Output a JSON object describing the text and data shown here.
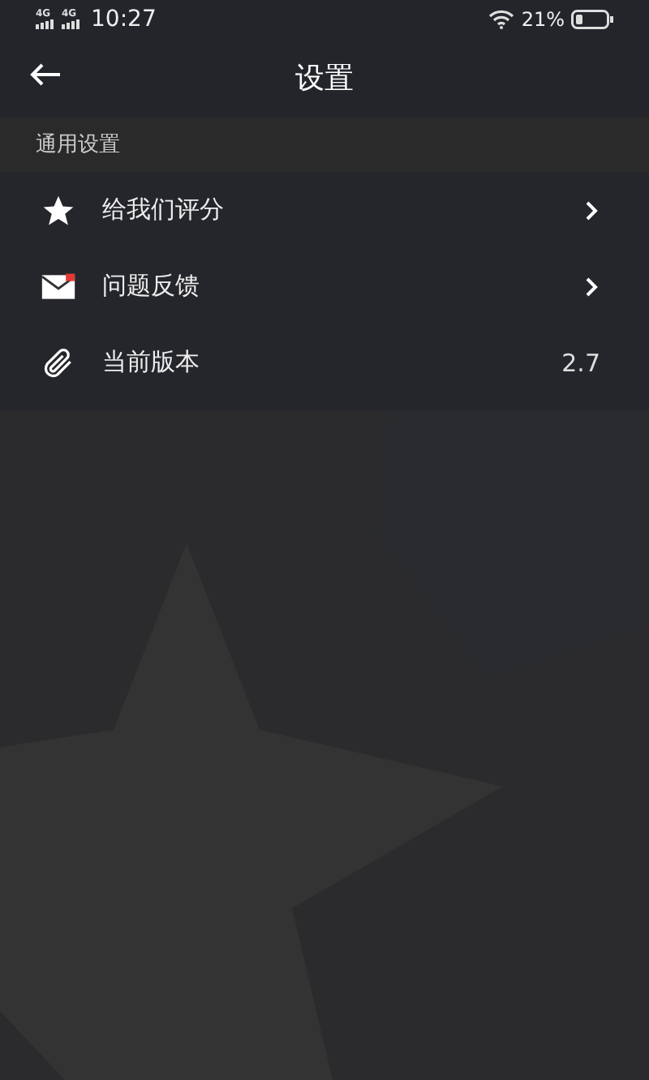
{
  "status_bar": {
    "networks": [
      "4G",
      "4G"
    ],
    "time": "10:27",
    "battery": "21%"
  },
  "header": {
    "title": "设置"
  },
  "section": {
    "title": "通用设置"
  },
  "items": [
    {
      "kind": "link",
      "label": "给我们评分"
    },
    {
      "kind": "link",
      "label": "问题反馈"
    },
    {
      "kind": "value",
      "label": "当前版本",
      "value": "2.7"
    }
  ]
}
